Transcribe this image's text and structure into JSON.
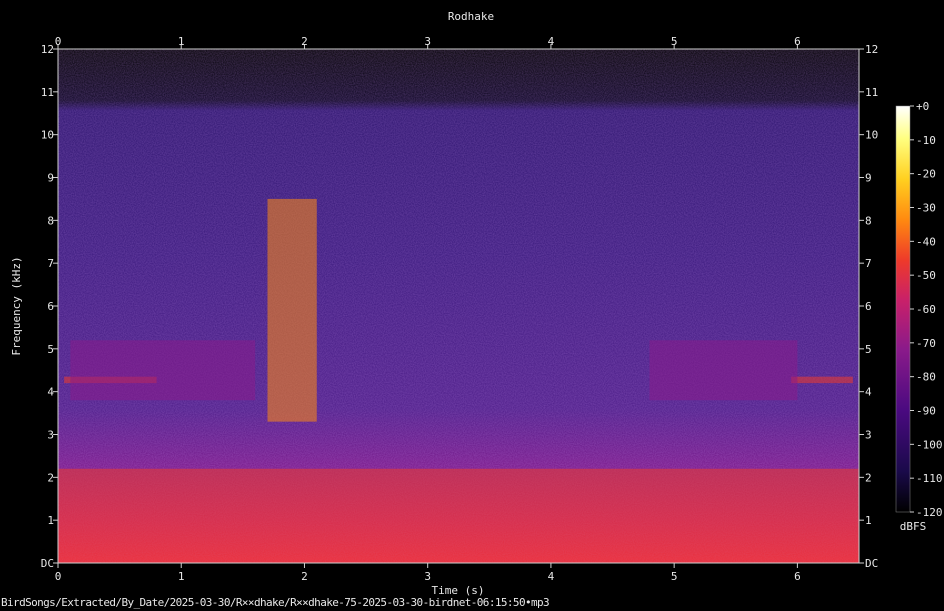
{
  "chart_data": {
    "type": "heatmap",
    "title": "Rodhake",
    "xlabel": "Time (s)",
    "ylabel": "Frequency (kHz)",
    "xlim": [
      0,
      6.5
    ],
    "ylim": [
      0,
      12
    ],
    "x_ticks": [
      "0",
      "1",
      "2",
      "3",
      "4",
      "5",
      "6"
    ],
    "y_ticks": [
      "DC",
      "1",
      "2",
      "3",
      "4",
      "5",
      "6",
      "7",
      "8",
      "9",
      "10",
      "11",
      "12"
    ],
    "colorbar": {
      "label": "dBFS",
      "ticks": [
        "+0",
        "-10",
        "-20",
        "-30",
        "-40",
        "-50",
        "-60",
        "-70",
        "-80",
        "-90",
        "-100",
        "-110",
        "-120"
      ],
      "range": [
        -120,
        0
      ],
      "colors": [
        "#000000",
        "#1a0a4a",
        "#4a0a80",
        "#8a1a8a",
        "#c8206a",
        "#ee3a2a",
        "#ff8a10",
        "#ffd020",
        "#ffff80",
        "#ffffff"
      ]
    },
    "features": [
      {
        "name": "noise floor",
        "t": [
          0,
          6.5
        ],
        "f": [
          0,
          2.2
        ],
        "level_db": -60
      },
      {
        "name": "harmonic band",
        "t": [
          0.05,
          0.8
        ],
        "f": [
          4.2,
          4.35
        ],
        "level_db": -55
      },
      {
        "name": "harmonic band",
        "t": [
          5.95,
          6.45
        ],
        "f": [
          4.2,
          4.35
        ],
        "level_db": -55
      },
      {
        "name": "call",
        "t": [
          1.7,
          2.1
        ],
        "f": [
          3.3,
          8.5
        ],
        "level_db": -35
      },
      {
        "name": "chirps",
        "t": [
          0.1,
          1.6
        ],
        "f": [
          3.8,
          5.2
        ],
        "level_db": -75
      },
      {
        "name": "chirps",
        "t": [
          4.8,
          6.0
        ],
        "f": [
          3.8,
          5.2
        ],
        "level_db": -75
      }
    ]
  },
  "footer": {
    "path": "BirdSongs/Extracted/By_Date/2025-03-30/R××dhake/R××dhake-75-2025-03-30-birdnet-06:15:50•mp3"
  }
}
